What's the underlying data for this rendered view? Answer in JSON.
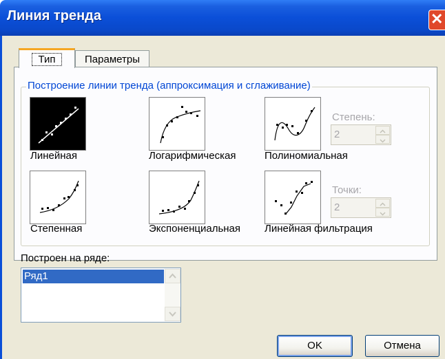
{
  "window": {
    "title": "Линия тренда",
    "close_icon": "close-icon"
  },
  "tabs": [
    {
      "label": "Тип",
      "selected": true
    },
    {
      "label": "Параметры",
      "selected": false
    }
  ],
  "group": {
    "title": "Построение линии тренда (аппроксимация и сглаживание)"
  },
  "trend_types": {
    "linear": {
      "label": "Линейная",
      "selected": true
    },
    "logarithmic": {
      "label": "Логарифмическая"
    },
    "polynomial": {
      "label": "Полиномиальная"
    },
    "power": {
      "label": "Степенная"
    },
    "exponential": {
      "label": "Экспоненциальная"
    },
    "moving_average": {
      "label": "Линейная фильтрация"
    }
  },
  "degree": {
    "label": "Степень:",
    "value": "2",
    "enabled": false
  },
  "period": {
    "label": "Точки:",
    "value": "2",
    "enabled": false
  },
  "series": {
    "label": "Построен на ряде:",
    "items": [
      "Ряд1"
    ],
    "selected": "Ряд1"
  },
  "buttons": {
    "ok": "OK",
    "cancel": "Отмена"
  },
  "colors": {
    "title_bar": "#0b4fd8",
    "group_title": "#0046d5",
    "selection": "#316ac5",
    "close": "#e0482a"
  }
}
